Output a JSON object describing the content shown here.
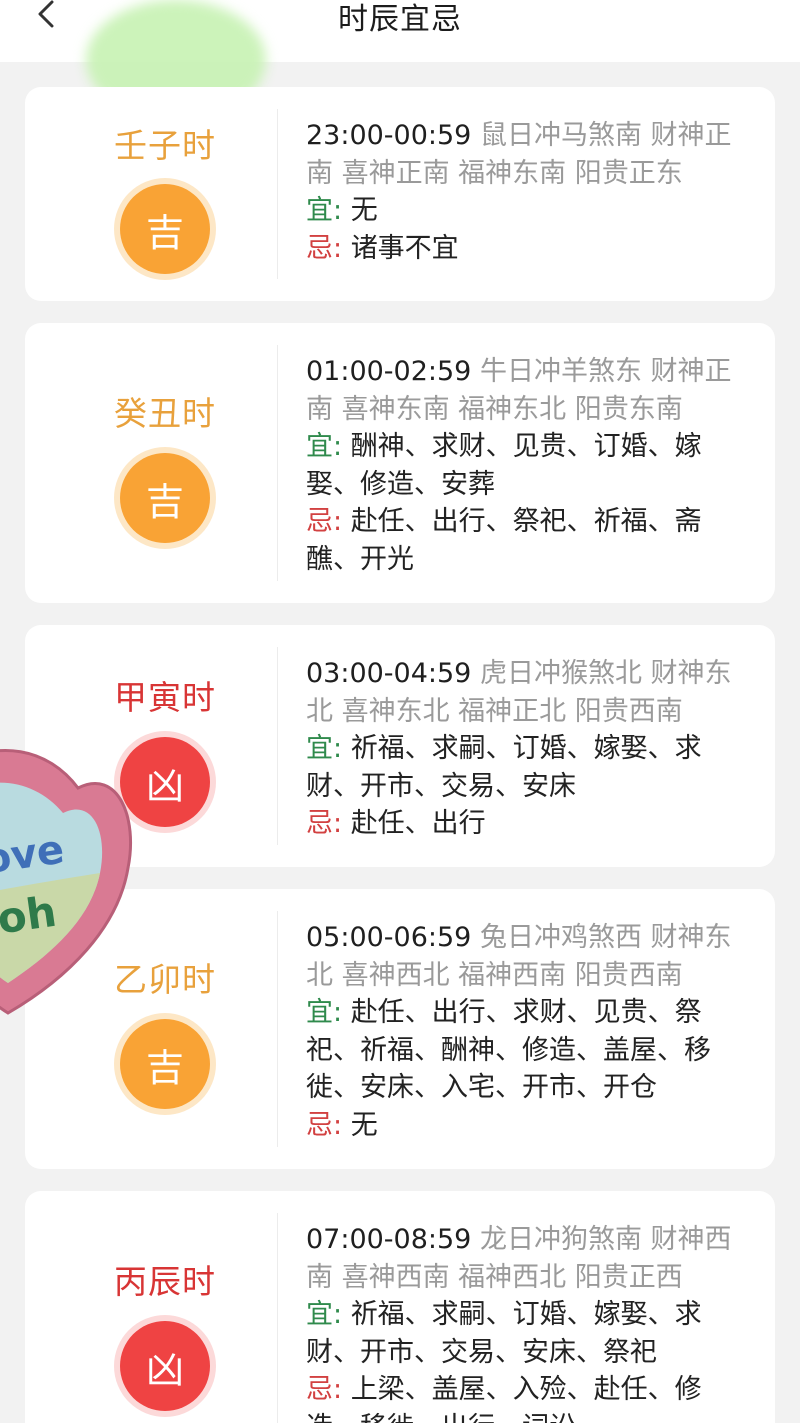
{
  "header": {
    "title": "时辰宜忌"
  },
  "labels": {
    "yi": "宜",
    "ji": "忌"
  },
  "colors": {
    "ji_fortune": "#f9a335",
    "xiong_fortune": "#ef4343",
    "yi_label": "#2f8a4c",
    "ji_label": "#d24141"
  },
  "cards": [
    {
      "shichen": "壬子时",
      "fortune": "吉",
      "fortune_type": "ji",
      "time": "23:00-00:59",
      "info": "鼠日冲马煞南 财神正南 喜神正南 福神东南 阳贵正东",
      "yi": "无",
      "ji": "诸事不宜"
    },
    {
      "shichen": "癸丑时",
      "fortune": "吉",
      "fortune_type": "ji",
      "time": "01:00-02:59",
      "info": "牛日冲羊煞东 财神正南 喜神东南 福神东北 阳贵东南",
      "yi": "酬神、求财、见贵、订婚、嫁娶、修造、安葬",
      "ji": "赴任、出行、祭祀、祈福、斋醮、开光"
    },
    {
      "shichen": "甲寅时",
      "fortune": "凶",
      "fortune_type": "xiong",
      "time": "03:00-04:59",
      "info": "虎日冲猴煞北 财神东北 喜神东北 福神正北 阳贵西南",
      "yi": "祈福、求嗣、订婚、嫁娶、求财、开市、交易、安床",
      "ji": "赴任、出行"
    },
    {
      "shichen": "乙卯时",
      "fortune": "吉",
      "fortune_type": "ji",
      "time": "05:00-06:59",
      "info": "兔日冲鸡煞西 财神东北 喜神西北 福神西南 阳贵西南",
      "yi": "赴任、出行、求财、见贵、祭祀、祈福、酬神、修造、盖屋、移徙、安床、入宅、开市、开仓",
      "ji": "无"
    },
    {
      "shichen": "丙辰时",
      "fortune": "凶",
      "fortune_type": "xiong",
      "time": "07:00-08:59",
      "info": "龙日冲狗煞南 财神西南 喜神西南 福神西北 阳贵正西",
      "yi": "祈福、求嗣、订婚、嫁娶、求财、开市、交易、安床、祭祀",
      "ji": "上梁、盖屋、入殓、赴任、修造、移徙、出行、词讼"
    }
  ],
  "sticker": {
    "text_line1": "ove",
    "text_line2": "oh"
  }
}
